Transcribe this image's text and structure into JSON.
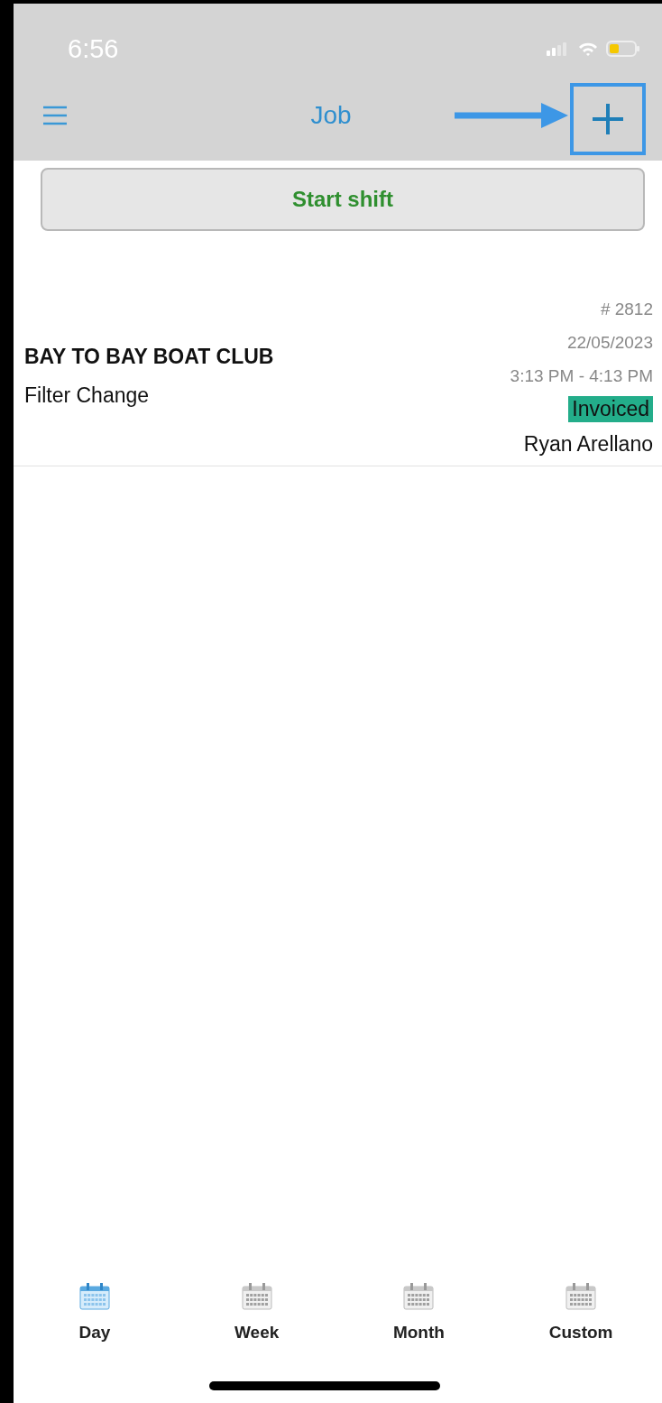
{
  "status_bar": {
    "time": "6:56"
  },
  "nav": {
    "title": "Job",
    "add_highlighted": true
  },
  "start_shift": {
    "label": "Start shift"
  },
  "jobs": [
    {
      "client": "BAY TO BAY BOAT CLUB",
      "service": "Filter Change",
      "number": "# 2812",
      "date": "22/05/2023",
      "time": "3:13 PM - 4:13 PM",
      "status": "Invoiced",
      "color": "#23ad8a",
      "technician": "Ryan Arellano"
    }
  ],
  "tabs": [
    {
      "label": "Day",
      "selected": true
    },
    {
      "label": "Week",
      "selected": false
    },
    {
      "label": "Month",
      "selected": false
    },
    {
      "label": "Custom",
      "selected": false
    }
  ]
}
